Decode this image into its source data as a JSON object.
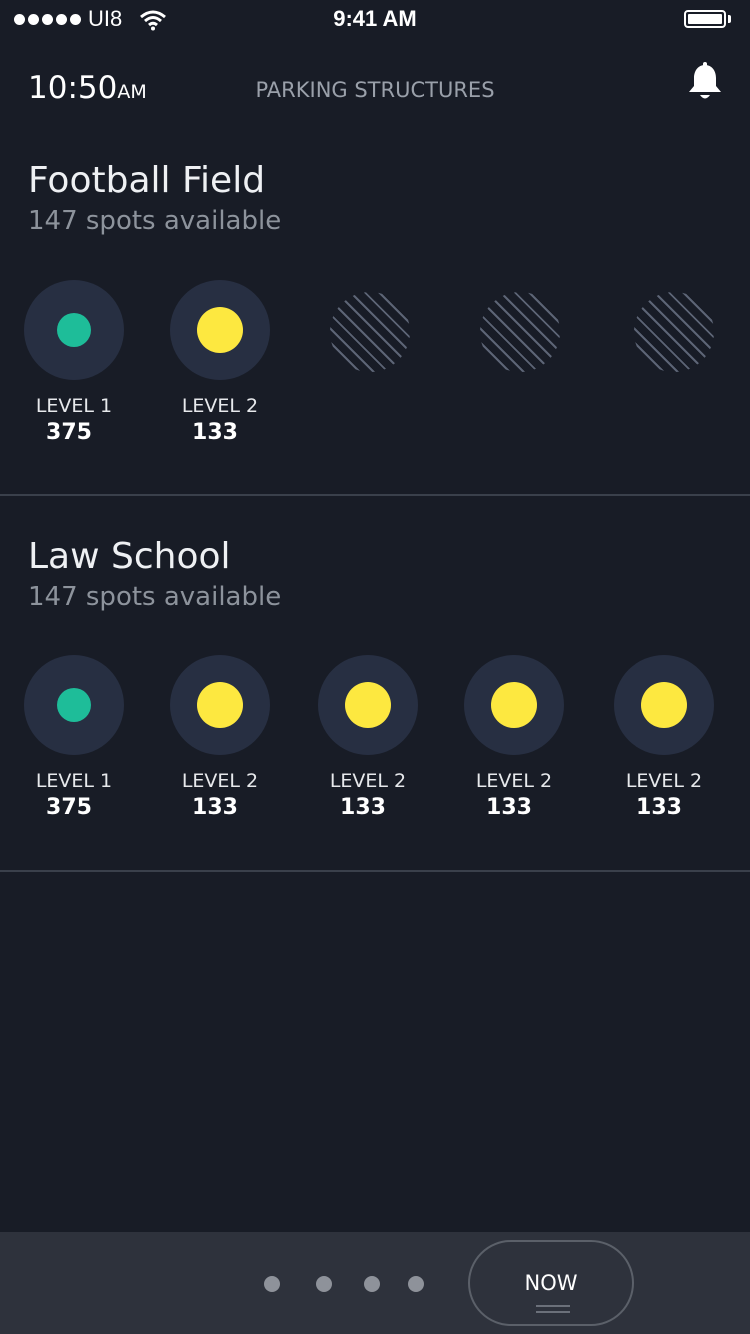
{
  "status_bar": {
    "carrier": "UI8",
    "time": "9:41 AM"
  },
  "header": {
    "time": "10:50",
    "ampm": "AM",
    "title": "PARKING STRUCTURES"
  },
  "sections": [
    {
      "name": "Football Field",
      "subtitle": "147 spots available",
      "levels": [
        {
          "label": "LEVEL 1",
          "count": "375",
          "status": "green"
        },
        {
          "label": "LEVEL 2",
          "count": "133",
          "status": "yellow"
        }
      ],
      "unavailable_count": 3
    },
    {
      "name": "Law School",
      "subtitle": "147 spots available",
      "levels": [
        {
          "label": "LEVEL 1",
          "count": "375",
          "status": "green"
        },
        {
          "label": "LEVEL 2",
          "count": "133",
          "status": "yellow"
        },
        {
          "label": "LEVEL 2",
          "count": "133",
          "status": "yellow"
        },
        {
          "label": "LEVEL 2",
          "count": "133",
          "status": "yellow"
        },
        {
          "label": "LEVEL 2",
          "count": "133",
          "status": "yellow"
        }
      ]
    }
  ],
  "bottom_bar": {
    "page_count": 4,
    "now_label": "NOW"
  },
  "colors": {
    "background": "#181c26",
    "available_green": "#1ebd99",
    "limited_yellow": "#fde840",
    "ring": "#272f42"
  }
}
